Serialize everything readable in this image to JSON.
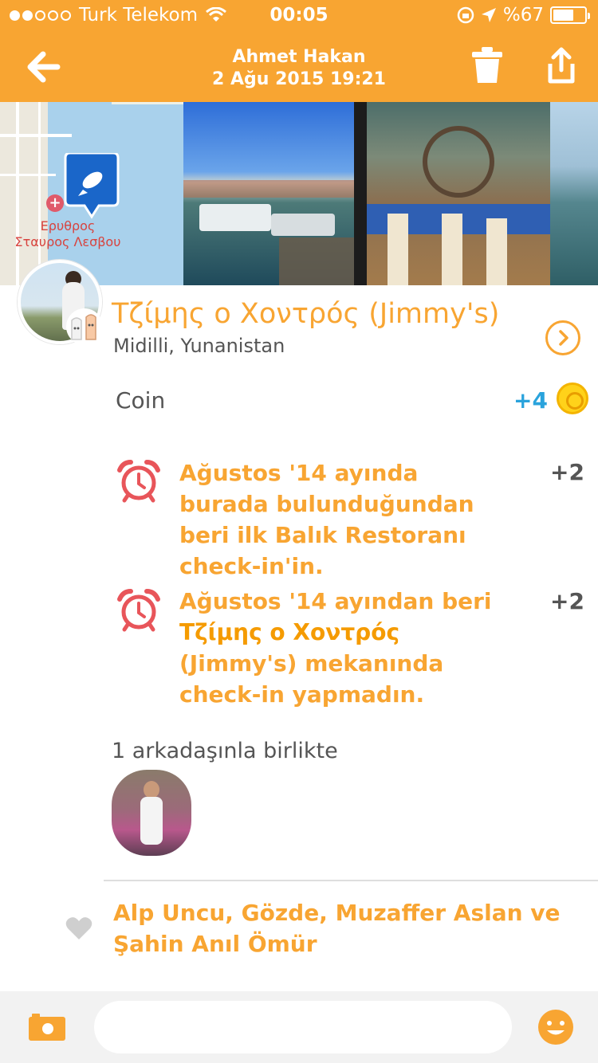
{
  "status_bar": {
    "carrier": "Turk Telekom",
    "time": "00:05",
    "battery": "%67",
    "battery_level": 0.67
  },
  "header": {
    "user_name": "Ahmet Hakan",
    "date": "2 Ağu 2015 19:21",
    "back_icon": "arrow-left-icon",
    "trash_icon": "trash-icon",
    "share_icon": "share-icon"
  },
  "photos": {
    "map_label_line1": "Ερυθρος",
    "map_label_line2": "Σταυρος Λεσβου",
    "pin_icon": "fish-icon"
  },
  "venue": {
    "name": "Τζίμης ο Χοντρός (Jimmy's)",
    "location": "Midilli, Yunanistan"
  },
  "coin": {
    "label": "Coin",
    "value": "+4"
  },
  "bonuses": [
    {
      "icon": "alarm-clock-icon",
      "text": "Ağustos '14 ayında burada bulunduğundan beri ilk Balık Restoranı check-in'in.",
      "points": "+2"
    },
    {
      "icon": "alarm-clock-icon",
      "text_pre": "Ağustos '14 ayından beri",
      "text_bold": "Τζίμης ο Χοντρός",
      "text_post": "(Jimmy's) mekanında check-in yapmadın.",
      "points": "+2"
    }
  ],
  "friends": {
    "label": "1 arkadaşınla birlikte"
  },
  "likes": {
    "text": "Alp Uncu, Gözde, Muzaffer Aslan ve Şahin Anıl Ömür"
  },
  "comment_bar": {
    "placeholder": ""
  },
  "colors": {
    "accent": "#f8a532",
    "coin_blue": "#2aa3dc",
    "alarm_red": "#e8555a"
  }
}
